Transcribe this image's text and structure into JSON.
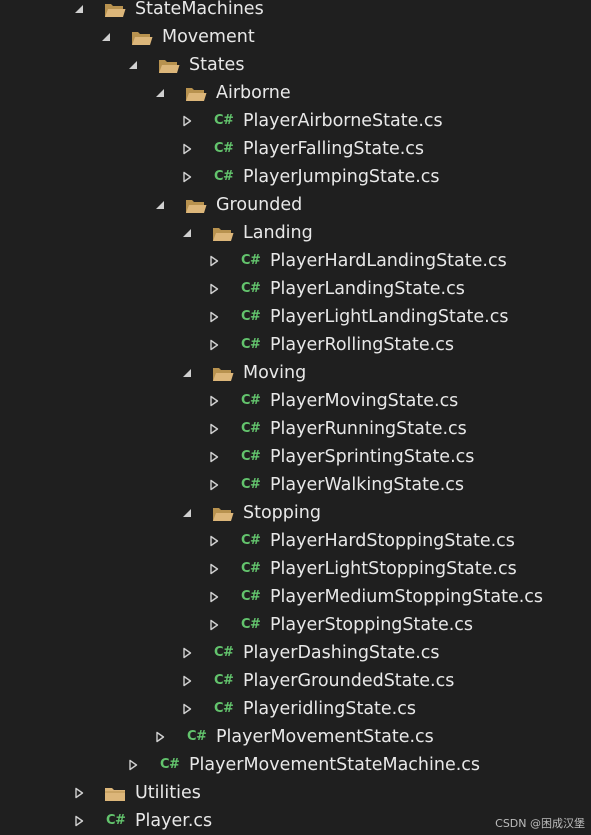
{
  "solution_explorer": {
    "nodes": [
      {
        "label": "StateMachines",
        "kind": "folder",
        "depth": 0,
        "expanded": true,
        "icon": "folder-open-icon"
      },
      {
        "label": "Movement",
        "kind": "folder",
        "depth": 1,
        "expanded": true,
        "icon": "folder-open-icon"
      },
      {
        "label": "States",
        "kind": "folder",
        "depth": 2,
        "expanded": true,
        "icon": "folder-open-icon"
      },
      {
        "label": "Airborne",
        "kind": "folder",
        "depth": 3,
        "expanded": true,
        "icon": "folder-open-icon"
      },
      {
        "label": "PlayerAirborneState.cs",
        "kind": "csharp",
        "depth": 4,
        "expanded": false,
        "icon": "csharp-file-icon"
      },
      {
        "label": "PlayerFallingState.cs",
        "kind": "csharp",
        "depth": 4,
        "expanded": false,
        "icon": "csharp-file-icon"
      },
      {
        "label": "PlayerJumpingState.cs",
        "kind": "csharp",
        "depth": 4,
        "expanded": false,
        "icon": "csharp-file-icon"
      },
      {
        "label": "Grounded",
        "kind": "folder",
        "depth": 3,
        "expanded": true,
        "icon": "folder-open-icon"
      },
      {
        "label": "Landing",
        "kind": "folder",
        "depth": 4,
        "expanded": true,
        "icon": "folder-open-icon"
      },
      {
        "label": "PlayerHardLandingState.cs",
        "kind": "csharp",
        "depth": 5,
        "expanded": false,
        "icon": "csharp-file-icon"
      },
      {
        "label": "PlayerLandingState.cs",
        "kind": "csharp",
        "depth": 5,
        "expanded": false,
        "icon": "csharp-file-icon"
      },
      {
        "label": "PlayerLightLandingState.cs",
        "kind": "csharp",
        "depth": 5,
        "expanded": false,
        "icon": "csharp-file-icon"
      },
      {
        "label": "PlayerRollingState.cs",
        "kind": "csharp",
        "depth": 5,
        "expanded": false,
        "icon": "csharp-file-icon"
      },
      {
        "label": "Moving",
        "kind": "folder",
        "depth": 4,
        "expanded": true,
        "icon": "folder-open-icon"
      },
      {
        "label": "PlayerMovingState.cs",
        "kind": "csharp",
        "depth": 5,
        "expanded": false,
        "icon": "csharp-file-icon"
      },
      {
        "label": "PlayerRunningState.cs",
        "kind": "csharp",
        "depth": 5,
        "expanded": false,
        "icon": "csharp-file-icon"
      },
      {
        "label": "PlayerSprintingState.cs",
        "kind": "csharp",
        "depth": 5,
        "expanded": false,
        "icon": "csharp-file-icon"
      },
      {
        "label": "PlayerWalkingState.cs",
        "kind": "csharp",
        "depth": 5,
        "expanded": false,
        "icon": "csharp-file-icon"
      },
      {
        "label": "Stopping",
        "kind": "folder",
        "depth": 4,
        "expanded": true,
        "icon": "folder-open-icon"
      },
      {
        "label": "PlayerHardStoppingState.cs",
        "kind": "csharp",
        "depth": 5,
        "expanded": false,
        "icon": "csharp-file-icon"
      },
      {
        "label": "PlayerLightStoppingState.cs",
        "kind": "csharp",
        "depth": 5,
        "expanded": false,
        "icon": "csharp-file-icon"
      },
      {
        "label": "PlayerMediumStoppingState.cs",
        "kind": "csharp",
        "depth": 5,
        "expanded": false,
        "icon": "csharp-file-icon"
      },
      {
        "label": "PlayerStoppingState.cs",
        "kind": "csharp",
        "depth": 5,
        "expanded": false,
        "icon": "csharp-file-icon"
      },
      {
        "label": "PlayerDashingState.cs",
        "kind": "csharp",
        "depth": 4,
        "expanded": false,
        "icon": "csharp-file-icon"
      },
      {
        "label": "PlayerGroundedState.cs",
        "kind": "csharp",
        "depth": 4,
        "expanded": false,
        "icon": "csharp-file-icon"
      },
      {
        "label": "PlayeridlingState.cs",
        "kind": "csharp",
        "depth": 4,
        "expanded": false,
        "icon": "csharp-file-icon"
      },
      {
        "label": "PlayerMovementState.cs",
        "kind": "csharp",
        "depth": 3,
        "expanded": false,
        "icon": "csharp-file-icon"
      },
      {
        "label": "PlayerMovementStateMachine.cs",
        "kind": "csharp",
        "depth": 2,
        "expanded": false,
        "icon": "csharp-file-icon"
      },
      {
        "label": "Utilities",
        "kind": "folder",
        "depth": 0,
        "expanded": false,
        "icon": "folder-closed-icon"
      },
      {
        "label": "Player.cs",
        "kind": "csharp",
        "depth": 0,
        "expanded": false,
        "icon": "csharp-file-icon"
      }
    ]
  },
  "csharp_glyph": "C#",
  "watermark": "CSDN @困成汉堡",
  "colors": {
    "background": "#1f1f1f",
    "text": "#e8e8e8",
    "arrow": "#d0d0d0",
    "folder": "#dcb67a",
    "folder_dark": "#b8924f",
    "csharp": "#63c46d"
  }
}
